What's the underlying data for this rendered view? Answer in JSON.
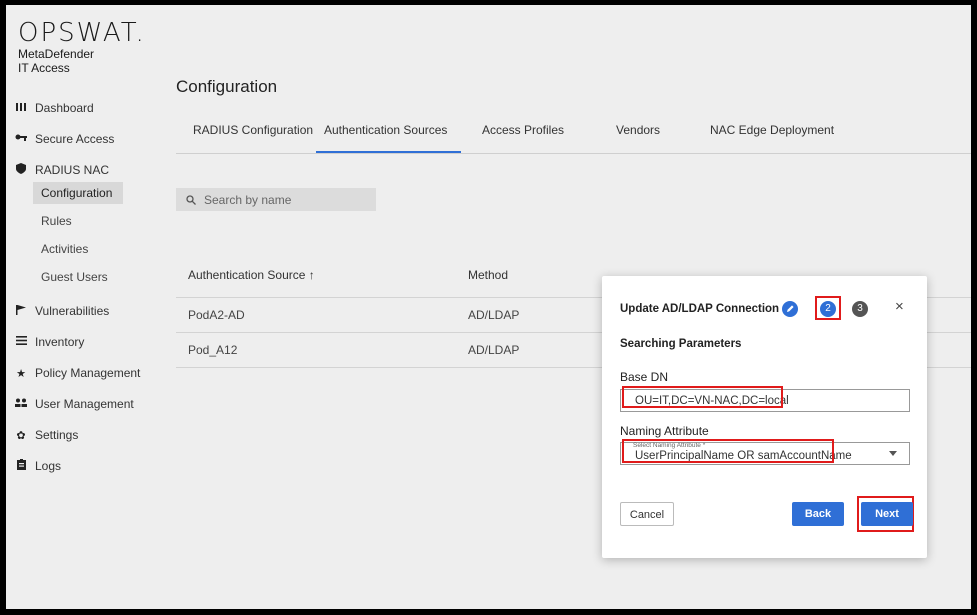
{
  "brand": {
    "logo": "OPSWAT.",
    "product_line1": "MetaDefender",
    "product_line2": "IT Access"
  },
  "sidebar": {
    "items": [
      {
        "label": "Dashboard",
        "icon": "bar-chart-icon"
      },
      {
        "label": "Secure Access",
        "icon": "key-icon"
      },
      {
        "label": "RADIUS NAC",
        "icon": "shield-icon"
      },
      {
        "label": "Vulnerabilities",
        "icon": "flag-icon"
      },
      {
        "label": "Inventory",
        "icon": "list-icon"
      },
      {
        "label": "Policy Management",
        "icon": "star-icon"
      },
      {
        "label": "User Management",
        "icon": "users-icon"
      },
      {
        "label": "Settings",
        "icon": "gear-icon"
      },
      {
        "label": "Logs",
        "icon": "clipboard-icon"
      }
    ],
    "radius_sub": [
      "Configuration",
      "Rules",
      "Activities",
      "Guest Users"
    ],
    "active_sub": "Configuration"
  },
  "page": {
    "title": "Configuration"
  },
  "tabs": [
    "RADIUS Configuration",
    "Authentication Sources",
    "Access Profiles",
    "Vendors",
    "NAC Edge Deployment"
  ],
  "active_tab": "Authentication Sources",
  "search": {
    "placeholder": "Search by name"
  },
  "table": {
    "columns": [
      "Authentication Source ↑",
      "Method"
    ],
    "rows": [
      [
        "PodA2-AD",
        "AD/LDAP"
      ],
      [
        "Pod_A12",
        "AD/LDAP"
      ]
    ]
  },
  "dialog": {
    "title": "Update AD/LDAP Connection",
    "steps": [
      "2",
      "3"
    ],
    "current_step": "2",
    "section": "Searching Parameters",
    "base_dn_label": "Base DN",
    "base_dn_value": "OU=IT,DC=VN-NAC,DC=local",
    "naming_label": "Naming Attribute",
    "naming_floating": "Select Naming Attribute *",
    "naming_value": "UserPrincipalName OR samAccountName",
    "cancel": "Cancel",
    "back": "Back",
    "next": "Next",
    "close_symbol": "×"
  },
  "colors": {
    "accent": "#2f6fd6",
    "step_done": "#2f6fd6",
    "step_pending": "#555555",
    "highlight": "#e01b1b"
  }
}
